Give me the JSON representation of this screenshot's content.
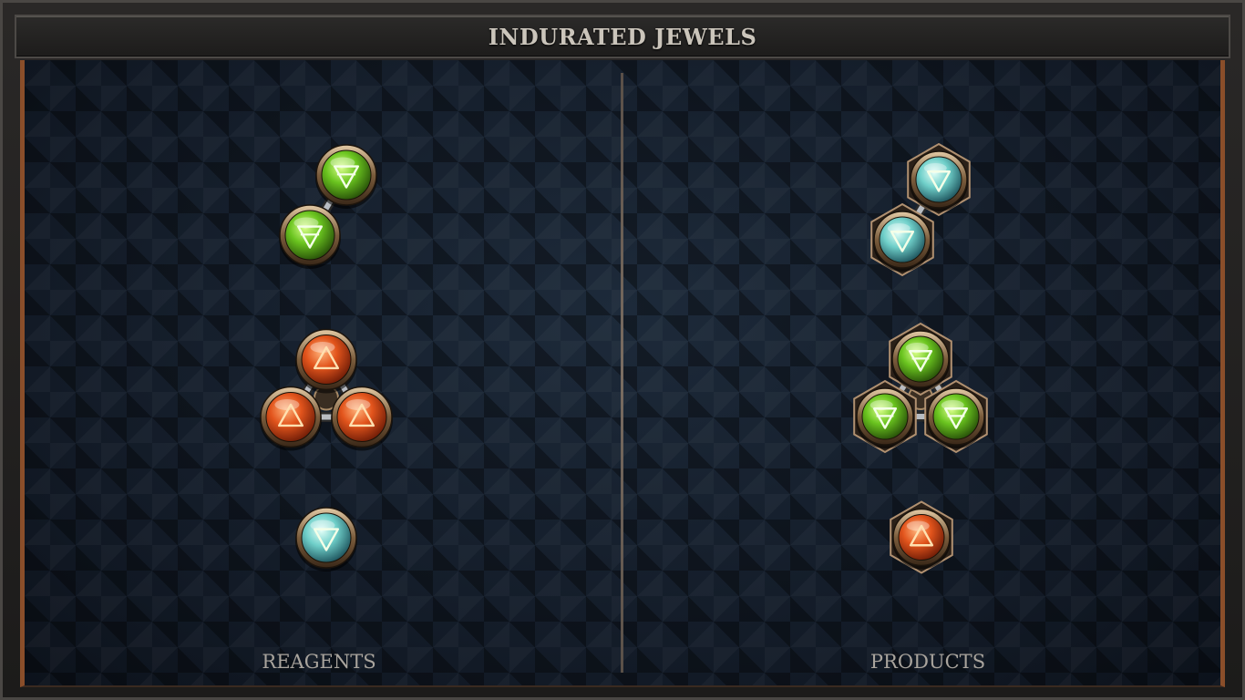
{
  "window": {
    "title": "INDURATED JEWELS"
  },
  "sections": {
    "reagents_label": "REAGENTS",
    "products_label": "PRODUCTS"
  },
  "colors": {
    "green": "#5fb81f",
    "red": "#e2541c",
    "cyan": "#6fcfc9",
    "accent_border": "#8a4e2a"
  },
  "reagents": [
    {
      "id": "reagent-1",
      "count": 2,
      "color": "green",
      "symbol": "earth-triangle",
      "frame": "round"
    },
    {
      "id": "reagent-2",
      "count": 3,
      "color": "red",
      "symbol": "fire-triangle",
      "frame": "round"
    },
    {
      "id": "reagent-3",
      "count": 1,
      "color": "cyan",
      "symbol": "water-triangle",
      "frame": "round"
    }
  ],
  "products": [
    {
      "id": "product-1",
      "count": 2,
      "color": "cyan",
      "symbol": "water-triangle",
      "frame": "hexagon"
    },
    {
      "id": "product-2",
      "count": 3,
      "color": "green",
      "symbol": "earth-triangle",
      "frame": "hexagon"
    },
    {
      "id": "product-3",
      "count": 1,
      "color": "red",
      "symbol": "fire-triangle",
      "frame": "hexagon"
    }
  ]
}
